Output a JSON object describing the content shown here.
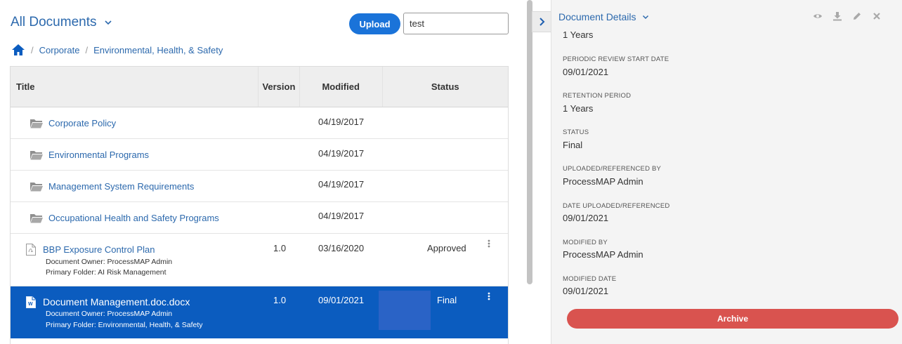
{
  "header": {
    "view_title": "All Documents",
    "upload_label": "Upload",
    "search_value": "test"
  },
  "breadcrumb": [
    "Corporate",
    "Environmental, Health, & Safety"
  ],
  "table": {
    "columns": [
      "Title",
      "Version",
      "Modified",
      "Status"
    ],
    "folders": [
      {
        "name": "Corporate Policy",
        "modified": "04/19/2017"
      },
      {
        "name": "Environmental Programs",
        "modified": "04/19/2017"
      },
      {
        "name": "Management System Requirements",
        "modified": "04/19/2017"
      },
      {
        "name": "Occupational Health and Safety Programs",
        "modified": "04/19/2017"
      }
    ],
    "documents": [
      {
        "name": "BBP Exposure Control Plan",
        "version": "1.0",
        "modified": "03/16/2020",
        "status": "Approved",
        "owner": "Document Owner: ProcessMAP Admin",
        "folder": "Primary Folder: AI Risk Management",
        "icon": "pdf-file-icon"
      },
      {
        "name": "Document Management.doc.docx",
        "version": "1.0",
        "modified": "09/01/2021",
        "status": "Final",
        "owner": "Document Owner: ProcessMAP Admin",
        "folder": "Primary Folder: Environmental, Health, & Safety",
        "icon": "word-file-icon",
        "selected": true
      }
    ]
  },
  "panel": {
    "title": "Document Details",
    "top_value": "1 Years",
    "fields": [
      {
        "label": "PERIODIC REVIEW START DATE",
        "value": "09/01/2021"
      },
      {
        "label": "RETENTION PERIOD",
        "value": "1 Years"
      },
      {
        "label": "STATUS",
        "value": "Final"
      },
      {
        "label": "UPLOADED/REFERENCED BY",
        "value": "ProcessMAP Admin"
      },
      {
        "label": "DATE UPLOADED/REFERENCED",
        "value": "09/01/2021"
      },
      {
        "label": "MODIFIED BY",
        "value": "ProcessMAP Admin"
      },
      {
        "label": "MODIFIED DATE",
        "value": "09/01/2021"
      }
    ],
    "archive_label": "Archive"
  },
  "colors": {
    "accent": "#2c69ad",
    "upload_button": "#1a73d9",
    "selected_row": "#0b5cbf",
    "archive_button": "#d9534f"
  }
}
